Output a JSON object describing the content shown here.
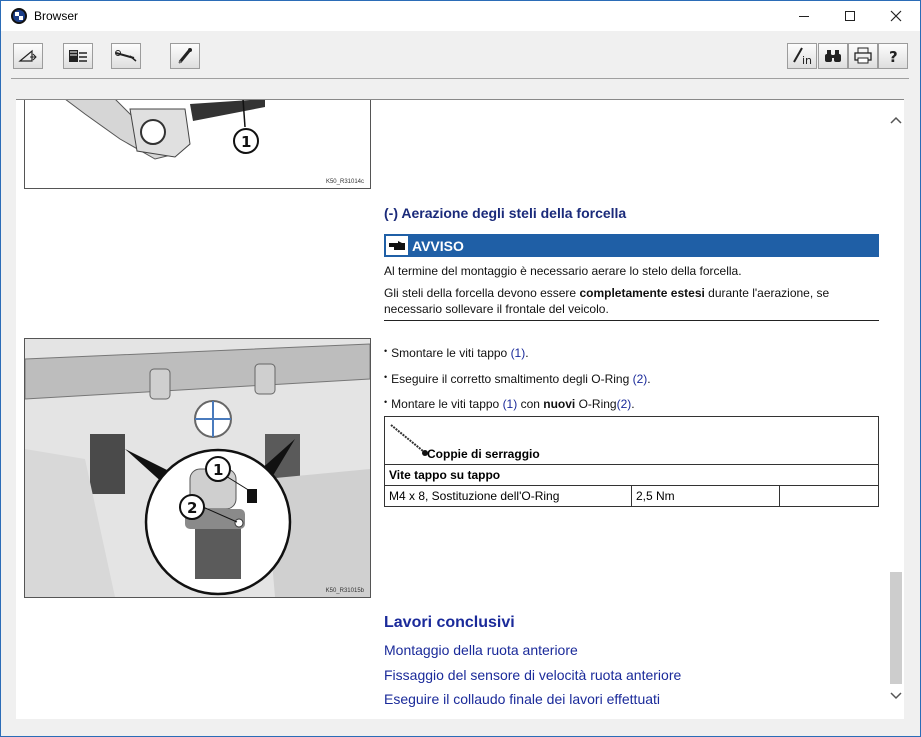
{
  "window": {
    "title": "Browser"
  },
  "toolbar": {
    "buttons_left": [
      "rotate-icon",
      "document-edit-icon",
      "tool-icon",
      "pen-icon"
    ],
    "buttons_right": [
      "sign-in-icon",
      "binoculars-icon",
      "print-icon",
      "help-icon"
    ]
  },
  "figure1": {
    "caption": "K50_R31014c",
    "callout": "1"
  },
  "figure2": {
    "caption": "K50_R31015b",
    "callout1": "1",
    "callout2": "2"
  },
  "section": {
    "title": "(-) Aerazione degli steli della forcella"
  },
  "notice": {
    "label": "AVVISO",
    "line1": "Al termine del montaggio è necessario aerare lo stelo della forcella.",
    "line2_a": "Gli steli della forcella devono essere ",
    "line2_bold": "completamente estesi",
    "line2_b": " durante l'aerazione, se",
    "line3": "necessario sollevare il frontale del veicolo."
  },
  "steps": [
    {
      "text": "Smontare le viti tappo ",
      "ref": "(1)",
      "tail": "."
    },
    {
      "text": "Eseguire il corretto smaltimento degli O-Ring ",
      "ref": "(2)",
      "tail": "."
    },
    {
      "text": "Montare le viti tappo ",
      "ref": "(1)",
      "mid": " con ",
      "bold": "nuovi",
      "mid2": " O-Ring",
      "ref2": "(2)",
      "tail": "."
    }
  ],
  "torque": {
    "header": "Coppie di serraggio",
    "subheader": "Vite tappo su tappo",
    "row": {
      "item": "M4 x 8, Sostituzione dell'O-Ring",
      "value": "2,5 Nm",
      "extra": ""
    }
  },
  "final": {
    "title": "Lavori conclusivi",
    "links": [
      "Montaggio della ruota anteriore",
      "Fissaggio del sensore di velocità ruota anteriore",
      "Eseguire il collaudo finale dei lavori effettuati"
    ]
  },
  "colors": {
    "accent": "#1f5fa6",
    "link": "#1a2a9a",
    "title_text": "#1a2a7a"
  }
}
